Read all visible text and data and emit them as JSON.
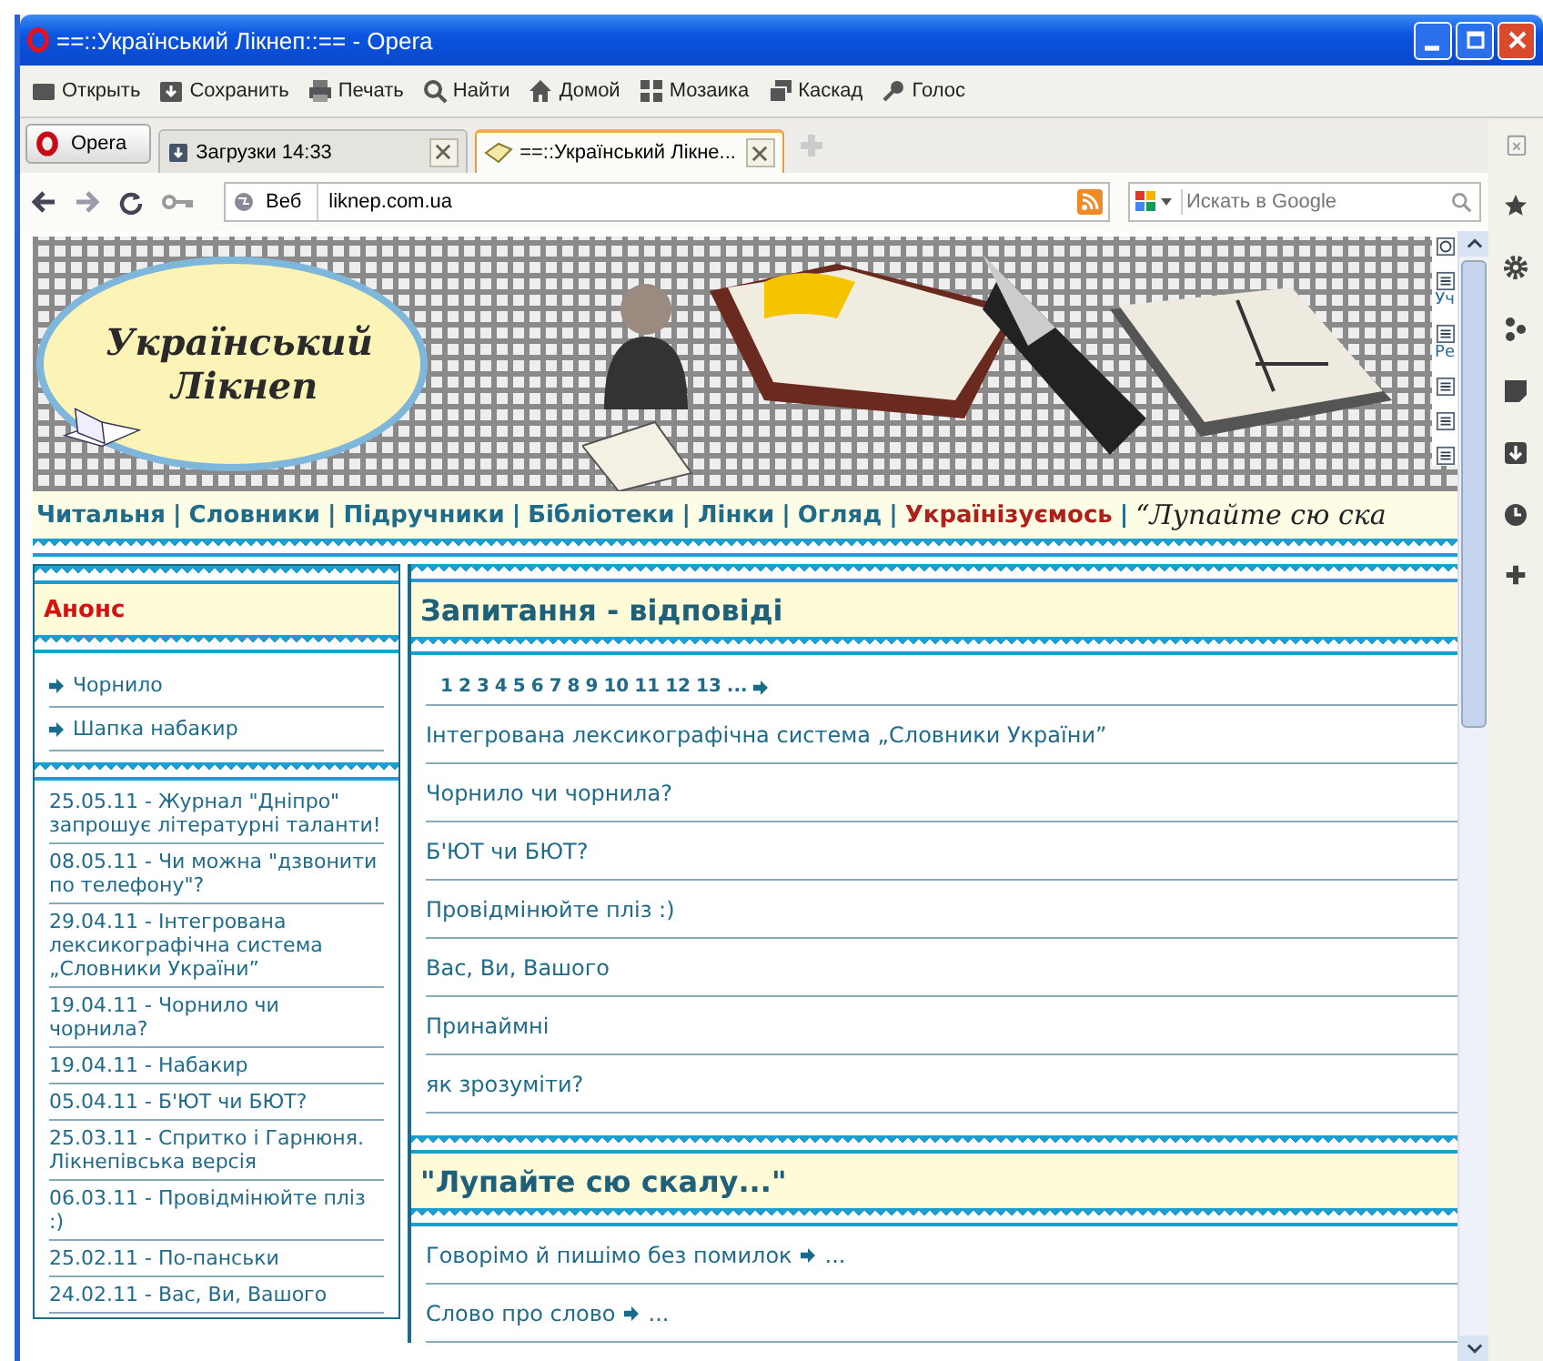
{
  "window": {
    "title": "==::Український Лікнеп::== - Opera"
  },
  "toolbar": [
    {
      "label": "Открыть"
    },
    {
      "label": "Сохранить"
    },
    {
      "label": "Печать"
    },
    {
      "label": "Найти"
    },
    {
      "label": "Домой"
    },
    {
      "label": "Мозаика"
    },
    {
      "label": "Каскад"
    },
    {
      "label": "Голос"
    }
  ],
  "menu_button": {
    "label": "Opera"
  },
  "tabs": [
    {
      "label": "Загрузки 14:33",
      "selected": false
    },
    {
      "label": "==::Український Лікне...",
      "selected": true
    }
  ],
  "address_bar": {
    "mode": "Веб",
    "url": "liknep.com.ua"
  },
  "search": {
    "placeholder": "Искать в Google"
  },
  "page": {
    "logo": {
      "line1": "Український",
      "line2": "Лікнеп"
    },
    "side_tools": [
      "Уч",
      "Ре"
    ],
    "nav_separator": "|",
    "nav": [
      {
        "label": "Читальня",
        "highlighted": false
      },
      {
        "label": "Словники",
        "highlighted": false
      },
      {
        "label": "Підручники",
        "highlighted": false
      },
      {
        "label": "Бібліотеки",
        "highlighted": false
      },
      {
        "label": "Лінки",
        "highlighted": false
      },
      {
        "label": "Огляд",
        "highlighted": false
      },
      {
        "label": "Українізуємось",
        "highlighted": true
      }
    ],
    "slogan": "“Лупайте сю ска",
    "announce": {
      "title": "Анонс",
      "items": [
        "Чорнило",
        "Шапка набакир"
      ]
    },
    "news": [
      "25.05.11 - Журнал \"Дніпро\" запрошує літературні таланти!",
      "08.05.11 - Чи можна \"дзвонити по телефону\"?",
      "29.04.11 - Інтегрована лексикографічна система „Словники України”",
      "19.04.11 - Чорнило чи чорнила?",
      "19.04.11 - Набакир",
      "05.04.11 - Б'ЮТ чи БЮТ?",
      "25.03.11 - Спритко і Гарнюня. Лікнепівська версія",
      "06.03.11 - Провідмінюйте пліз :)",
      "25.02.11 - По-панськи",
      "24.02.11 - Вас, Ви, Вашого"
    ],
    "qa": {
      "title": "Запитання - відповіді",
      "pages": [
        "1",
        "2",
        "3",
        "4",
        "5",
        "6",
        "7",
        "8",
        "9",
        "10",
        "11",
        "12",
        "13",
        "..."
      ],
      "items": [
        "Інтегрована лексикографічна система „Словники України”",
        "Чорнило чи чорнила?",
        "Б'ЮТ чи БЮТ?",
        "Провідмінюйте пліз :)",
        "Вас, Ви, Вашого",
        "Принаймні",
        "як зрозуміти?"
      ]
    },
    "section2": {
      "title": "\"Лупайте сю скалу...\"",
      "items": [
        {
          "label": "Говорімо й пишімо без помилок",
          "more": "..."
        },
        {
          "label": "Слово про слово",
          "more": "..."
        }
      ]
    }
  }
}
